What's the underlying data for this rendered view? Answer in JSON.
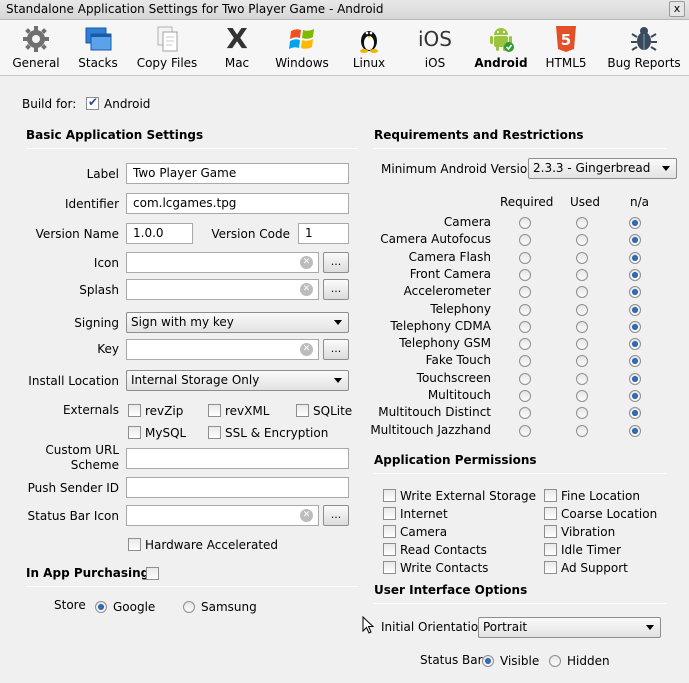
{
  "window": {
    "title": "Standalone Application Settings for Two Player Game - Android",
    "close": "x"
  },
  "toolbar": [
    {
      "label": "General",
      "icon": "gear-icon"
    },
    {
      "label": "Stacks",
      "icon": "stacks-icon"
    },
    {
      "label": "Copy Files",
      "icon": "copy-files-icon"
    },
    {
      "label": "Mac",
      "icon": "mac-x-icon"
    },
    {
      "label": "Windows",
      "icon": "windows-icon"
    },
    {
      "label": "Linux",
      "icon": "linux-penguin-icon"
    },
    {
      "label": "iOS",
      "icon": "ios-icon"
    },
    {
      "label": "Android",
      "icon": "android-icon"
    },
    {
      "label": "HTML5",
      "icon": "html5-icon"
    },
    {
      "label": "Bug Reports",
      "icon": "bug-icon"
    }
  ],
  "toolbar_glyphs": {
    "ios": "iOS",
    "mac": "X",
    "html5": "5",
    "copy": "❐"
  },
  "build_for": {
    "label": "Build for:",
    "platform": "Android",
    "checked": true
  },
  "basic": {
    "title": "Basic Application Settings",
    "label_lbl": "Label",
    "label_val": "Two Player Game",
    "identifier_lbl": "Identifier",
    "identifier_val": "com.lcgames.tpg",
    "version_name_lbl": "Version Name",
    "version_name_val": "1.0.0",
    "version_code_lbl": "Version Code",
    "version_code_val": "1",
    "icon_lbl": "Icon",
    "splash_lbl": "Splash",
    "signing_lbl": "Signing",
    "signing_val": "Sign with my key",
    "key_lbl": "Key",
    "install_lbl": "Install Location",
    "install_val": "Internal Storage Only",
    "externals_lbl": "Externals",
    "externals": [
      "revZip",
      "revXML",
      "SQLite",
      "MySQL",
      "SSL & Encryption"
    ],
    "custom_url_lbl": "Custom URL Scheme",
    "push_lbl": "Push Sender ID",
    "status_icon_lbl": "Status Bar Icon",
    "hw_accel": "Hardware Accelerated",
    "browse": "...",
    "clear": "✕"
  },
  "iap": {
    "title": "In App Purchasing",
    "store_lbl": "Store",
    "stores": [
      "Google",
      "Samsung"
    ],
    "selected": "Google"
  },
  "requirements": {
    "title": "Requirements and Restrictions",
    "min_version_lbl": "Minimum Android Version",
    "min_version_val": "2.3.3 - Gingerbread",
    "columns": [
      "Required",
      "Used",
      "n/a"
    ],
    "rows": [
      "Camera",
      "Camera Autofocus",
      "Camera Flash",
      "Front Camera",
      "Accelerometer",
      "Telephony",
      "Telephony CDMA",
      "Telephony GSM",
      "Fake Touch",
      "Touchscreen",
      "Multitouch",
      "Multitouch Distinct",
      "Multitouch Jazzhand"
    ],
    "selected": "n/a"
  },
  "permissions": {
    "title": "Application Permissions",
    "left": [
      "Write External Storage",
      "Internet",
      "Camera",
      "Read Contacts",
      "Write Contacts"
    ],
    "right": [
      "Fine Location",
      "Coarse Location",
      "Vibration",
      "Idle Timer",
      "Ad Support"
    ]
  },
  "ui": {
    "title": "User Interface Options",
    "orientation_lbl": "Initial Orientation",
    "orientation_val": "Portrait",
    "statusbar_lbl": "Status Bar",
    "statusbar_opts": [
      "Visible",
      "Hidden"
    ],
    "statusbar_selected": "Visible"
  }
}
